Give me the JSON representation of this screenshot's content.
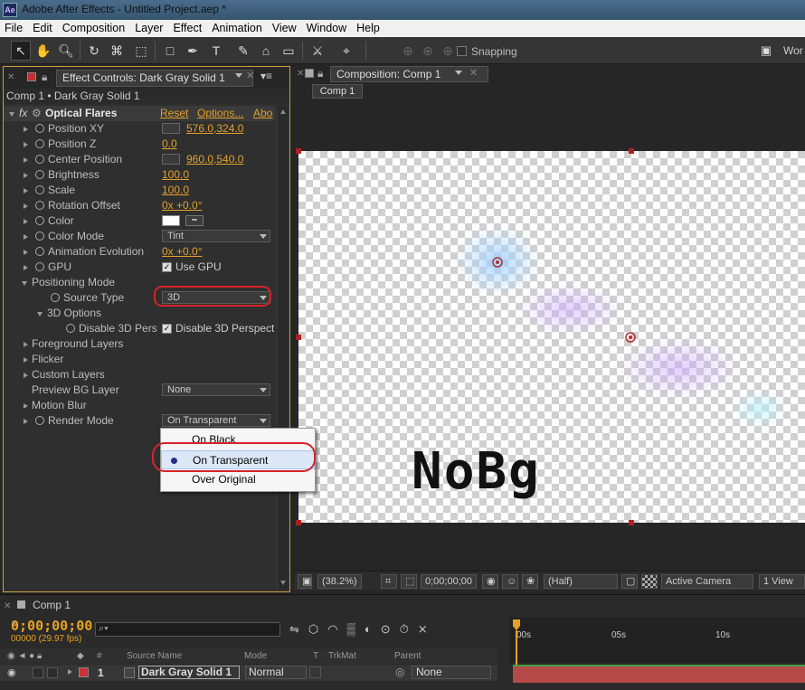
{
  "window": {
    "app_icon": "Ae",
    "title": "Adobe After Effects - Untitled Project.aep *"
  },
  "menubar": [
    "File",
    "Edit",
    "Composition",
    "Layer",
    "Effect",
    "Animation",
    "View",
    "Window",
    "Help"
  ],
  "toolbar": {
    "snapping_label": "Snapping",
    "snapping_checked": false,
    "truncated": "Wor"
  },
  "effect_controls": {
    "tab_title": "Effect Controls: Dark Gray Solid 1",
    "breadcrumb": "Comp 1 • Dark Gray Solid 1",
    "effect": {
      "fx": "fx",
      "name": "Optical Flares",
      "reset": "Reset",
      "options": "Options...",
      "about": "Abo"
    },
    "params": [
      {
        "name": "Position XY",
        "value": "576.0,324.0"
      },
      {
        "name": "Position Z",
        "value": "0.0"
      },
      {
        "name": "Center Position",
        "value": "960.0,540.0"
      },
      {
        "name": "Brightness",
        "value": "100.0"
      },
      {
        "name": "Scale",
        "value": "100.0"
      },
      {
        "name": "Rotation Offset",
        "value": "0x +0.0°"
      },
      {
        "name": "Color",
        "value": ""
      },
      {
        "name": "Color Mode",
        "value": "Tint"
      },
      {
        "name": "Animation Evolution",
        "value": "0x +0.0°"
      },
      {
        "name": "GPU",
        "value": "Use GPU"
      }
    ],
    "positioning_mode": "Positioning Mode",
    "source_type": {
      "name": "Source Type",
      "value": "3D"
    },
    "options_3d": "3D Options",
    "disable_3d": {
      "name": "Disable 3D Pers",
      "value": "Disable 3D Perspect"
    },
    "groups": [
      "Foreground Layers",
      "Flicker",
      "Custom Layers"
    ],
    "preview_bg": {
      "name": "Preview BG Layer",
      "value": "None"
    },
    "motion_blur": "Motion Blur",
    "render_mode": {
      "name": "Render Mode",
      "value": "On Transparent"
    }
  },
  "render_menu": {
    "items": [
      "On Black",
      "On Transparent",
      "Over Original"
    ],
    "selected": "On Transparent"
  },
  "composition": {
    "tab_title": "Composition: Comp 1",
    "crumb": "Comp 1",
    "overlay_text": "NoBg",
    "viewer": {
      "zoom": "(38.2%)",
      "timecode": "0;00;00;00",
      "resolution": "(Half)",
      "camera": "Active Camera",
      "views": "1 View"
    }
  },
  "timeline": {
    "tab": "Comp 1",
    "timecode": "0;00;00;00",
    "fps": "00000 (29.97 fps)",
    "headers": {
      "num": "#",
      "source": "Source Name",
      "mode": "Mode",
      "t": "T",
      "trkmat": "TrkMat",
      "parent": "Parent"
    },
    "ruler": [
      "00s",
      "05s",
      "10s"
    ],
    "layer": {
      "index": "1",
      "name": "Dark Gray Solid 1",
      "mode": "Normal",
      "parent": "None",
      "label_color": "#c83232"
    }
  },
  "colors": {
    "accent": "#e2a22b",
    "selection_ring": "#d8232a"
  }
}
